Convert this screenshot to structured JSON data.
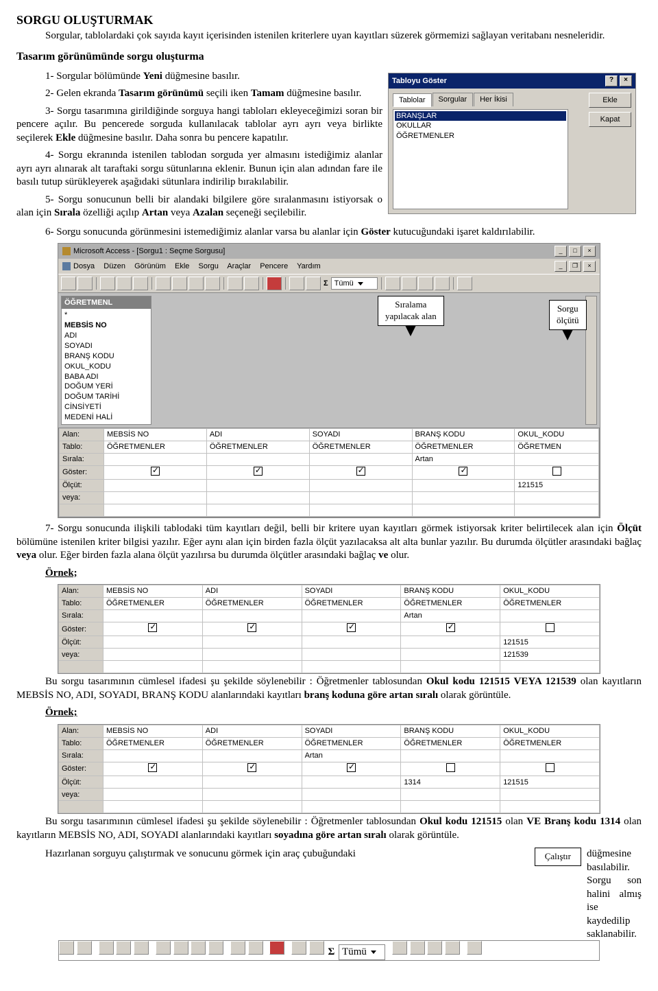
{
  "heading": "SORGU OLUŞTURMAK",
  "intro": "Sorgular, tablolardaki çok sayıda kayıt içerisinden istenilen kriterlere uyan kayıtları süzerek görmemizi sağlayan veritabanı nesneleridir.",
  "sub1": "Tasarım görünümünde sorgu oluşturma",
  "step1_a": "1-   Sorgular bölümünde ",
  "step1_b": "Yeni",
  "step1_c": " düğmesine basılır.",
  "step2_a": "2-   Gelen ekranda ",
  "step2_b": "Tasarım görünümü ",
  "step2_c": "seçili iken ",
  "step2_d": "Tamam",
  "step2_e": " düğmesine basılır.",
  "step3_a": "3-   Sorgu tasarımına girildiğinde sorguya hangi tabloları ekleyeceğimizi soran bir pencere açılır. Bu pencerede sorguda kullanılacak tablolar ayrı ayrı veya birlikte seçilerek ",
  "step3_b": "Ekle",
  "step3_c": " düğmesine basılır. Daha sonra bu pencere kapatılır.",
  "step4": "4-   Sorgu ekranında istenilen tablodan sorguda yer almasını istediğimiz alanlar ayrı ayrı alınarak alt taraftaki sorgu sütunlarına eklenir. Bunun için alan adından fare ile basılı tutup sürükleyerek aşağıdaki sütunlara indirilip bırakılabilir.",
  "step5_a": "5-   Sorgu sonucunun belli bir alandaki bilgilere göre sıralanmasını istiyorsak o alan için ",
  "step5_b": "Sırala",
  "step5_c": " özelliği açılıp ",
  "step5_d": "Artan",
  "step5_e": " veya ",
  "step5_f": "Azalan",
  "step5_g": " seçeneği seçilebilir.",
  "step6_a": "6-   Sorgu sonucunda görünmesini istemediğimiz alanlar varsa bu alanlar için ",
  "step6_b": "Göster",
  "step6_c": " kutucuğundaki işaret kaldırılabilir.",
  "dlg": {
    "title": "Tabloyu Göster",
    "tabs": [
      "Tablolar",
      "Sorgular",
      "Her İkisi"
    ],
    "items": [
      "BRANŞLAR",
      "OKULLAR",
      "ÖĞRETMENLER"
    ],
    "ekle": "Ekle",
    "kapat": "Kapat",
    "help": "?",
    "close": "×"
  },
  "access": {
    "wintitle": "Microsoft Access - [Sorgu1 : Seçme Sorgusu]",
    "menu": [
      "Dosya",
      "Düzen",
      "Görünüm",
      "Ekle",
      "Sorgu",
      "Araçlar",
      "Pencere",
      "Yardım"
    ],
    "combo": "Tümü",
    "table": {
      "hdr": "ÖĞRETMENL",
      "fields": [
        "*",
        "MEBSİS NO",
        "ADI",
        "SOYADI",
        "BRANŞ KODU",
        "OKUL_KODU",
        "BABA ADI",
        "DOĞUM YERİ",
        "DOĞUM TARİHİ",
        "CİNSİYETİ",
        "MEDENİ HALİ"
      ]
    }
  },
  "callout1": "Sıralama\nyapılacak alan",
  "callout2": "Sorgu ölçütü",
  "gridLabels": {
    "alan": "Alan:",
    "tablo": "Tablo:",
    "sirala": "Sırala:",
    "goster": "Göster:",
    "olcut": "Ölçüt:",
    "veya": "veya:"
  },
  "grid1": {
    "alan": [
      "MEBSİS NO",
      "ADI",
      "SOYADI",
      "BRANŞ KODU",
      "OKUL_KODU"
    ],
    "tablo": [
      "ÖĞRETMENLER",
      "ÖĞRETMENLER",
      "ÖĞRETMENLER",
      "ÖĞRETMENLER",
      "ÖĞRETMEN"
    ],
    "sirala": [
      "",
      "",
      "",
      "Artan",
      ""
    ],
    "olcut": [
      "",
      "",
      "",
      "",
      "121515"
    ],
    "veya": [
      "",
      "",
      "",
      "",
      ""
    ]
  },
  "step7_a": "7-   Sorgu sonucunda ilişkili tablodaki tüm kayıtları değil, belli bir kritere uyan kayıtları görmek istiyorsak kriter belirtilecek alan için ",
  "step7_b": "Ölçüt",
  "step7_c": " bölümüne istenilen kriter bilgisi yazılır. Eğer aynı alan için birden fazla ölçüt yazılacaksa alt alta bunlar yazılır. Bu durumda ölçütler arasındaki bağlaç ",
  "step7_d": "veya",
  "step7_e": " olur. Eğer birden fazla alana ölçüt yazılırsa bu durumda ölçütler arasındaki bağlaç ",
  "step7_f": "ve",
  "step7_g": " olur.",
  "ornek": "Örnek;",
  "grid2": {
    "alan": [
      "MEBSİS NO",
      "ADI",
      "SOYADI",
      "BRANŞ KODU",
      "OKUL_KODU"
    ],
    "tablo": [
      "ÖĞRETMENLER",
      "ÖĞRETMENLER",
      "ÖĞRETMENLER",
      "ÖĞRETMENLER",
      "ÖĞRETMENLER"
    ],
    "sirala": [
      "",
      "",
      "",
      "Artan",
      ""
    ],
    "olcut": [
      "",
      "",
      "",
      "",
      "121515"
    ],
    "veya": [
      "",
      "",
      "",
      "",
      "121539"
    ]
  },
  "para2_a": "Bu sorgu tasarımının cümlesel ifadesi şu şekilde söylenebilir : Öğretmenler tablosundan ",
  "para2_b": "Okul kodu 121515 VEYA 121539",
  "para2_c": " olan kayıtların MEBSİS NO, ADI, SOYADI, BRANŞ KODU alanlarındaki kayıtları ",
  "para2_d": "branş koduna göre artan sıralı",
  "para2_e": " olarak görüntüle.",
  "grid3": {
    "alan": [
      "MEBSİS NO",
      "ADI",
      "SOYADI",
      "BRANŞ KODU",
      "OKUL_KODU"
    ],
    "tablo": [
      "ÖĞRETMENLER",
      "ÖĞRETMENLER",
      "ÖĞRETMENLER",
      "ÖĞRETMENLER",
      "ÖĞRETMENLER"
    ],
    "sirala": [
      "",
      "",
      "Artan",
      "",
      ""
    ],
    "olcut": [
      "",
      "",
      "",
      "1314",
      "121515"
    ],
    "veya": [
      "",
      "",
      "",
      "",
      ""
    ]
  },
  "para3_a": "Bu sorgu tasarımının cümlesel ifadesi şu şekilde söylenebilir : Öğretmenler tablosundan ",
  "para3_b": "Okul kodu 121515",
  "para3_c": " olan ",
  "para3_d": "VE Branş kodu 1314",
  "para3_e": " olan kayıtların MEBSİS NO, ADI, SOYADI alanlarındaki kayıtları ",
  "para3_f": "soyadına göre artan sıralı",
  "para3_g": " olarak görüntüle.",
  "para4_a": "Hazırlanan sorguyu çalıştırmak ve sonucunu görmek için araç çubuğundaki ",
  "para4_b": "düğmesine basılabilir. Sorgu son halini almış ise kaydedilip saklanabilir.",
  "runlabel": "Çalıştır"
}
